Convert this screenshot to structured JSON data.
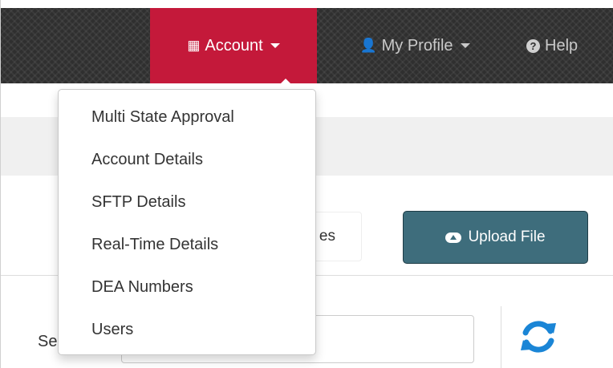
{
  "navbar": {
    "account": {
      "label": "Account",
      "icon": "building-icon",
      "bg": "#c4193a"
    },
    "profile": {
      "label": "My Profile",
      "icon": "user-icon"
    },
    "help": {
      "label": "Help",
      "icon": "question-circle-icon"
    }
  },
  "account_menu": {
    "items": [
      {
        "label": "Multi State Approval"
      },
      {
        "label": "Account Details"
      },
      {
        "label": "SFTP Details"
      },
      {
        "label": "Real-Time Details"
      },
      {
        "label": "DEA Numbers"
      },
      {
        "label": "Users"
      }
    ]
  },
  "toolbar": {
    "partial_button_label": "es",
    "upload_label": "Upload File",
    "upload_color": "#3e6d7c"
  },
  "search": {
    "label_partial": "Se",
    "value": ""
  },
  "refresh": {
    "icon": "refresh-icon",
    "color": "#1a85d6"
  }
}
